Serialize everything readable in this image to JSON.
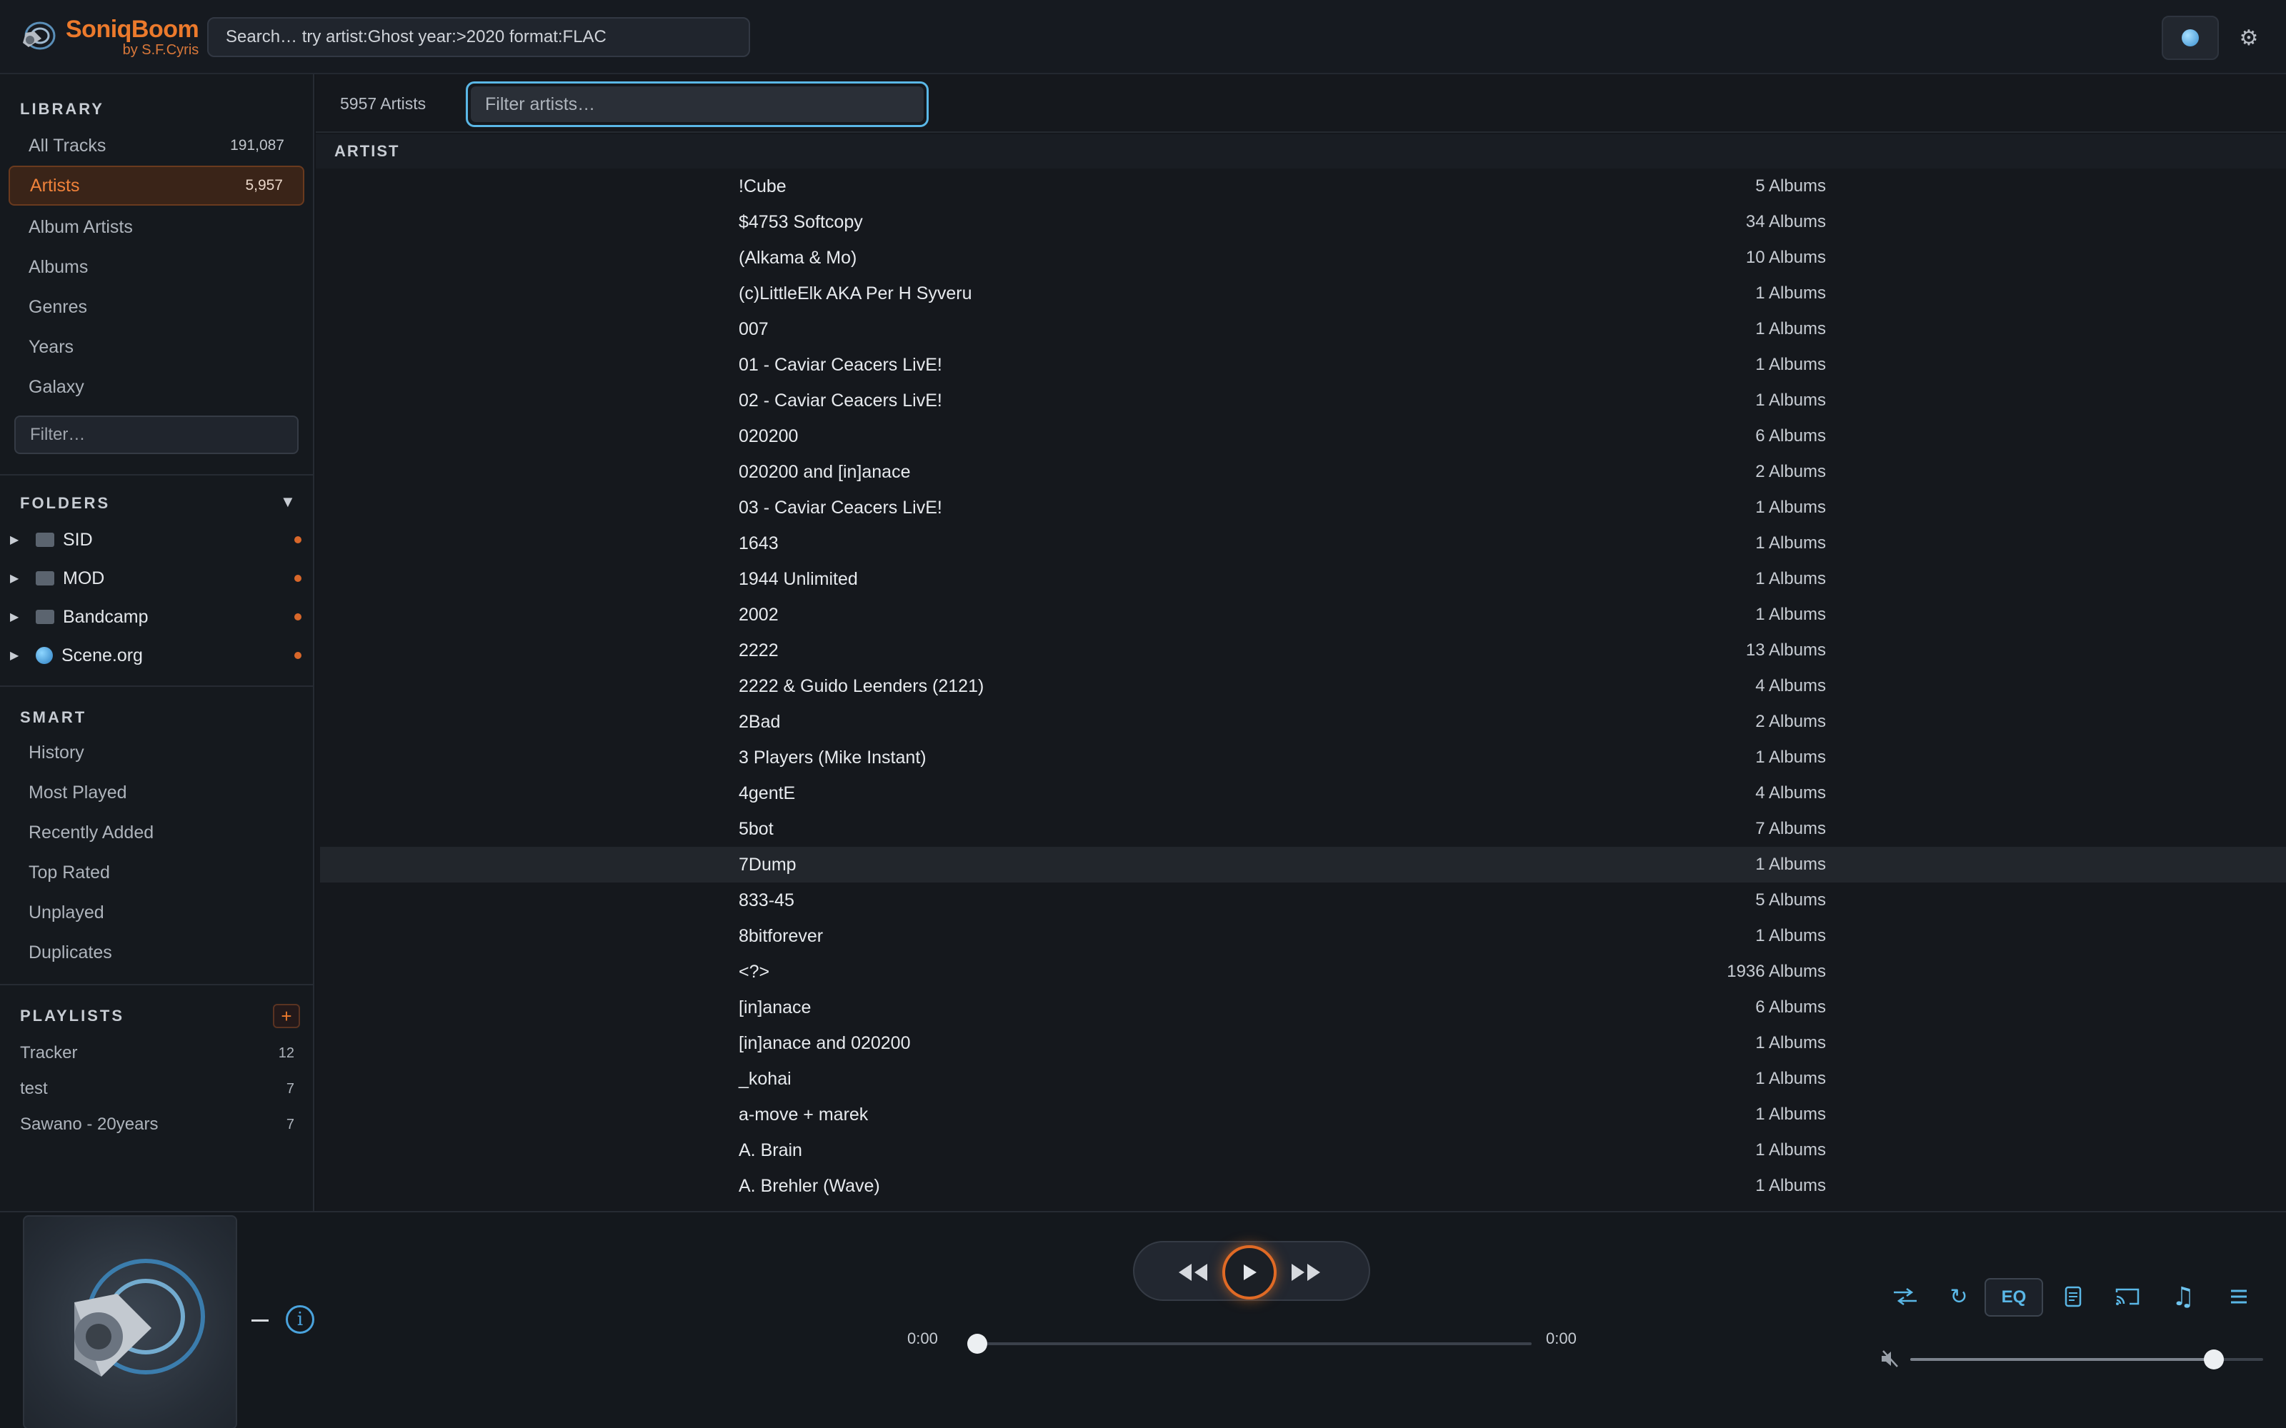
{
  "app": {
    "title": "SoniqBoom",
    "subtitle": "by S.F.Cyris"
  },
  "search": {
    "placeholder": "Search… try  artist:Ghost  year:>2020  format:FLAC"
  },
  "sidebar": {
    "library_title": "LIBRARY",
    "library": [
      {
        "label": "All Tracks",
        "count": "191,087"
      },
      {
        "label": "Artists",
        "count": "5,957",
        "active": true
      },
      {
        "label": "Album Artists",
        "count": ""
      },
      {
        "label": "Albums",
        "count": ""
      },
      {
        "label": "Genres",
        "count": ""
      },
      {
        "label": "Years",
        "count": ""
      },
      {
        "label": "Galaxy",
        "count": ""
      }
    ],
    "filter_placeholder": "Filter…",
    "folders_title": "FOLDERS",
    "folders_toggle": "▼",
    "folders": [
      {
        "label": "SID",
        "icon": "folder-icon"
      },
      {
        "label": "MOD",
        "icon": "folder-icon"
      },
      {
        "label": "Bandcamp",
        "icon": "folder-icon"
      },
      {
        "label": "Scene.org",
        "icon": "globe-icon"
      }
    ],
    "smart_title": "SMART",
    "smart": [
      "History",
      "Most Played",
      "Recently Added",
      "Top Rated",
      "Unplayed",
      "Duplicates"
    ],
    "playlists_title": "PLAYLISTS",
    "playlist_add": "+",
    "playlists": [
      {
        "label": "Tracker",
        "count": "12"
      },
      {
        "label": "test",
        "count": "7"
      },
      {
        "label": "Sawano - 20years",
        "count": "7"
      }
    ]
  },
  "main": {
    "count_label": "5957 Artists",
    "filter_placeholder": "Filter artists…",
    "column_header": "ARTIST",
    "selected_index": 19,
    "rows": [
      {
        "name": "!Cube",
        "albums": "5 Albums"
      },
      {
        "name": "$4753 Softcopy",
        "albums": "34 Albums"
      },
      {
        "name": "(Alkama & Mo)",
        "albums": "10 Albums"
      },
      {
        "name": "(c)LittleElk AKA Per H Syveru",
        "albums": "1 Albums"
      },
      {
        "name": "007",
        "albums": "1 Albums"
      },
      {
        "name": "01 - Caviar Ceacers LivE!",
        "albums": "1 Albums"
      },
      {
        "name": "02 - Caviar Ceacers LivE!",
        "albums": "1 Albums"
      },
      {
        "name": "020200",
        "albums": "6 Albums"
      },
      {
        "name": "020200 and [in]anace",
        "albums": "2 Albums"
      },
      {
        "name": "03 - Caviar Ceacers LivE!",
        "albums": "1 Albums"
      },
      {
        "name": "1643",
        "albums": "1 Albums"
      },
      {
        "name": "1944 Unlimited",
        "albums": "1 Albums"
      },
      {
        "name": "2002",
        "albums": "1 Albums"
      },
      {
        "name": "2222",
        "albums": "13 Albums"
      },
      {
        "name": "2222 & Guido Leenders (2121)",
        "albums": "4 Albums"
      },
      {
        "name": "2Bad",
        "albums": "2 Albums"
      },
      {
        "name": "3 Players (Mike Instant)",
        "albums": "1 Albums"
      },
      {
        "name": "4gentE",
        "albums": "4 Albums"
      },
      {
        "name": "5bot",
        "albums": "7 Albums"
      },
      {
        "name": "7Dump",
        "albums": "1 Albums"
      },
      {
        "name": "833-45",
        "albums": "5 Albums"
      },
      {
        "name": "8bitforever",
        "albums": "1 Albums"
      },
      {
        "name": "<?>",
        "albums": "1936 Albums"
      },
      {
        "name": "[in]anace",
        "albums": "6 Albums"
      },
      {
        "name": "[in]anace and 020200",
        "albums": "1 Albums"
      },
      {
        "name": "_kohai",
        "albums": "1 Albums"
      },
      {
        "name": "a-move + marek",
        "albums": "1 Albums"
      },
      {
        "name": "A. Brain",
        "albums": "1 Albums"
      },
      {
        "name": "A. Brehler (Wave)",
        "albums": "1 Albums"
      }
    ]
  },
  "player": {
    "track_title": "–",
    "info_label": "i",
    "time_elapsed": "0:00",
    "time_total": "0:00",
    "progress": 0,
    "volume": 0.86,
    "eq_label": "EQ",
    "accent_color": "#ec7a2c",
    "highlight_color": "#5ab7e6"
  }
}
